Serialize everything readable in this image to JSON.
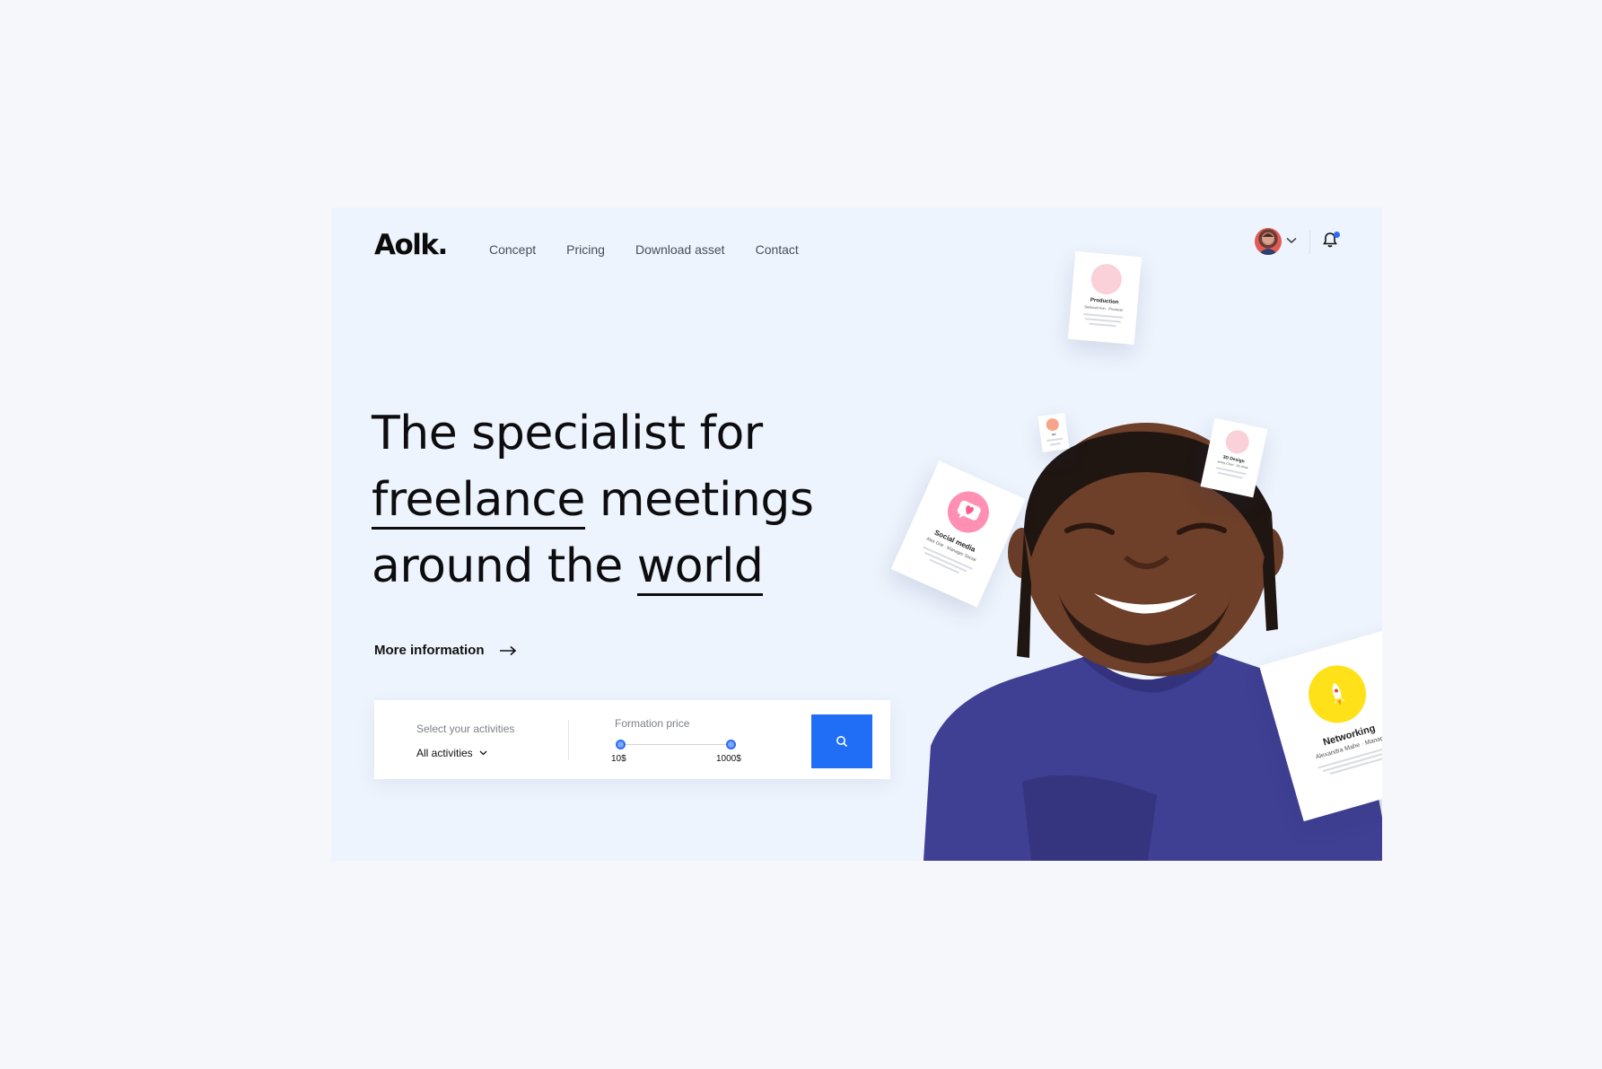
{
  "brand": {
    "logo": "Aolk."
  },
  "nav": {
    "items": [
      {
        "label": "Concept"
      },
      {
        "label": "Pricing"
      },
      {
        "label": "Download asset"
      },
      {
        "label": "Contact"
      }
    ]
  },
  "header": {
    "avatar_icon": "user-avatar",
    "chevron_icon": "chevron-down-icon",
    "notification_icon": "bell-icon",
    "notification_badge_color": "#2b6cf6"
  },
  "hero": {
    "line1": "The specialist for",
    "line2_underlined": "freelance",
    "line2_rest": " meetings",
    "line3_rest": "around the ",
    "line3_underlined": "world",
    "cta_label": "More information",
    "cta_icon": "arrow-right-icon"
  },
  "search": {
    "activities_label": "Select your activities",
    "activities_value": "All activities",
    "price_label": "Formation price",
    "price_min": "10$",
    "price_max": "1000$",
    "button_icon": "search-icon",
    "accent_color": "#1f6ef5"
  },
  "cards": {
    "production": {
      "title": "Production",
      "sub": "Deborah Fon · Producer"
    },
    "tiny": {
      "title": "Art"
    },
    "design3d": {
      "title": "3D Design",
      "sub": "Jenny Chen · 3D Artist"
    },
    "social": {
      "title": "Social media",
      "sub": "Alex Doe · Manager Social"
    },
    "network": {
      "title": "Networking",
      "sub": "Alexandra Mahe · Manager"
    }
  }
}
